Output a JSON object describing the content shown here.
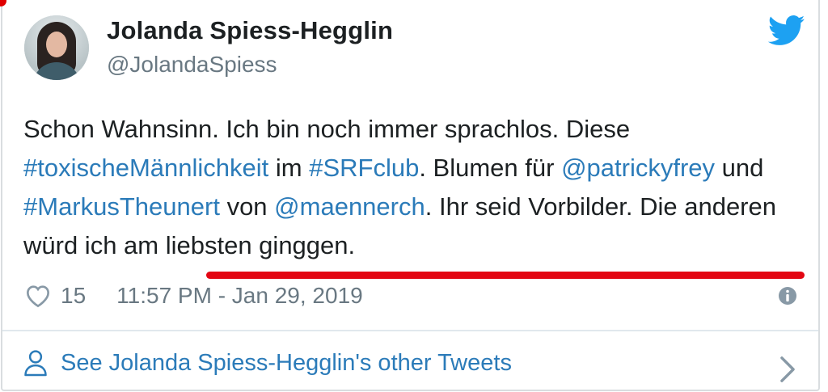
{
  "author": {
    "name": "Jolanda Spiess-Hegglin",
    "handle": "@JolandaSpiess",
    "avatar_icon": "profile-photo"
  },
  "brand": {
    "icon": "twitter-bird-icon",
    "color": "#1da1f2"
  },
  "tweet": {
    "segments": [
      {
        "text": "Schon Wahnsinn. Ich bin noch immer sprachlos. Diese ",
        "type": "text"
      },
      {
        "text": "#toxischeMännlichkeit",
        "type": "link"
      },
      {
        "text": " im ",
        "type": "text"
      },
      {
        "text": "#SRFclub",
        "type": "link"
      },
      {
        "text": ". Blumen für ",
        "type": "text"
      },
      {
        "text": "@patrickyfrey",
        "type": "link"
      },
      {
        "text": " und ",
        "type": "text"
      },
      {
        "text": "#MarkusTheunert",
        "type": "link"
      },
      {
        "text": " von ",
        "type": "text"
      },
      {
        "text": "@maennerch",
        "type": "link"
      },
      {
        "text": ". Ihr seid Vorbilder. Die anderen würd ich am liebsten ginggen.",
        "type": "text"
      }
    ],
    "highlight_color": "#e30613",
    "link_color": "#2b7bb9"
  },
  "meta": {
    "like_icon": "heart-icon",
    "likes": "15",
    "timestamp": "11:57 PM - Jan 29, 2019",
    "info_icon": "info-icon"
  },
  "footer": {
    "label": "See Jolanda Spiess-Hegglin's other Tweets",
    "person_icon": "person-icon",
    "chevron_icon": "chevron-right-icon"
  }
}
